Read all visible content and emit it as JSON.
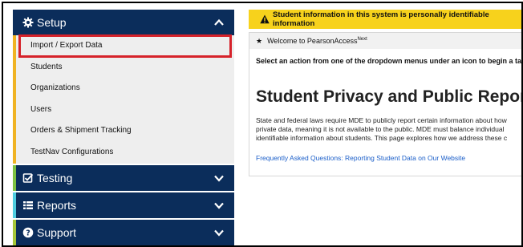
{
  "sidebar": {
    "setup": {
      "label": "Setup",
      "icon": "gear-icon",
      "expanded": true,
      "accent_color": "#f0b323",
      "items": [
        {
          "label": "Import / Export Data",
          "selected": true
        },
        {
          "label": "Students"
        },
        {
          "label": "Organizations"
        },
        {
          "label": "Users"
        },
        {
          "label": "Orders & Shipment Tracking"
        },
        {
          "label": "TestNav Configurations"
        }
      ]
    },
    "testing": {
      "label": "Testing",
      "icon": "check-square-icon",
      "accent_color": "#7cc242"
    },
    "reports": {
      "label": "Reports",
      "icon": "report-list-icon",
      "accent_color": "#4ecde0"
    },
    "support": {
      "label": "Support",
      "icon": "question-circle-icon",
      "accent_color": "#a5c638"
    }
  },
  "main": {
    "banner": "Student information in this system is personally identifiable information",
    "welcome": {
      "prefix": "Welcome to PearsonAccess",
      "superscript": "Next"
    },
    "instruction": "Select an action from one of the dropdown menus under an icon to begin a tas",
    "heading": "Student Privacy and Public Reports",
    "paragraph": [
      "State and federal laws require MDE to publicly report certain information about how",
      "private data, meaning it is not available to the public. MDE must balance individual",
      "identifiable information about students. This page explores how we address these c"
    ],
    "link": "Frequently Asked Questions: Reporting Student Data on Our Website"
  },
  "colors": {
    "nav_bg": "#0b2d5b",
    "submenu_bg": "#eeeeee",
    "highlight_border": "#d6222a",
    "banner_bg": "#f7d21c",
    "link": "#1a5ec9"
  }
}
